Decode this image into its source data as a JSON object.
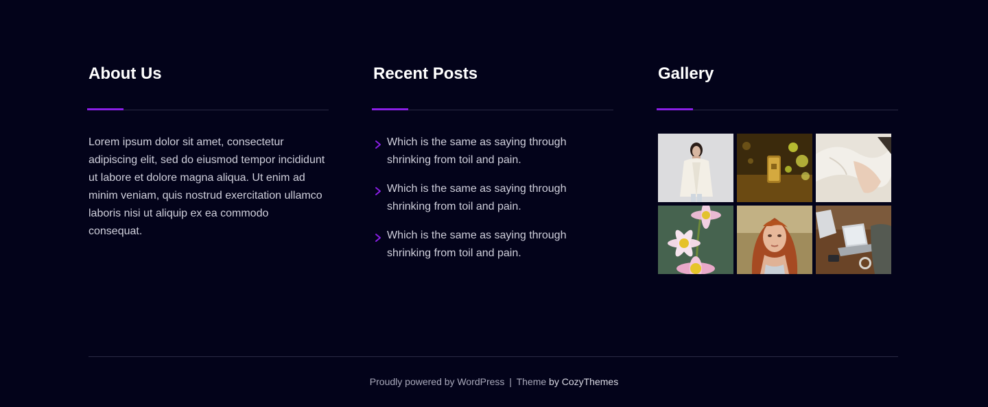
{
  "about": {
    "title": "About Us",
    "text": "Lorem ipsum dolor sit amet, consectetur adipiscing elit, sed do eiusmod tempor incididunt ut labore et dolore magna aliqua. Ut enim ad minim veniam, quis nostrud exercitation ullamco laboris nisi ut aliquip ex ea commodo consequat."
  },
  "recent_posts": {
    "title": "Recent Posts",
    "items": [
      {
        "label": "Which is the same as saying through shrinking from toil and pain."
      },
      {
        "label": "Which is the same as saying through shrinking from toil and pain."
      },
      {
        "label": "Which is the same as saying through shrinking from toil and pain."
      }
    ]
  },
  "gallery": {
    "title": "Gallery",
    "images": [
      {
        "subject": "woman-white-cardigan"
      },
      {
        "subject": "gold-smartphone-bokeh"
      },
      {
        "subject": "white-linen-bedding"
      },
      {
        "subject": "pink-daisy-flowers"
      },
      {
        "subject": "red-haired-woman-field"
      },
      {
        "subject": "laptop-on-wooden-desk"
      }
    ]
  },
  "footer": {
    "powered_text": "Proudly powered by WordPress",
    "separator": "|",
    "theme_prefix": "Theme",
    "theme_author": "by CozyThemes"
  },
  "colors": {
    "background": "#03031a",
    "accent": "#8a1fe6",
    "divider": "#2a2a45",
    "body_text": "#d0d0dc",
    "heading": "#ffffff"
  }
}
